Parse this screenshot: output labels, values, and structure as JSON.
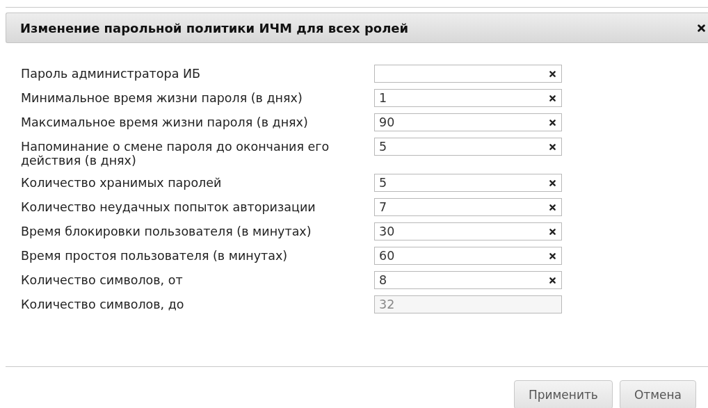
{
  "dialog": {
    "title": "Изменение парольной политики ИЧМ для всех ролей"
  },
  "fields": [
    {
      "label": "Пароль администратора ИБ",
      "disabled": false
    },
    {
      "label": "Минимальное время жизни пароля (в днях)",
      "value": "1",
      "disabled": false
    },
    {
      "label": "Максимальное время жизни пароля (в днях)",
      "value": "90",
      "disabled": false
    },
    {
      "label": "Напоминание о смене пароля до окончания его действия (в днях)",
      "value": "5",
      "disabled": false
    },
    {
      "label": "Количество хранимых паролей",
      "value": "5",
      "disabled": false
    },
    {
      "label": "Количество неудачных попыток авторизации",
      "value": "7",
      "disabled": false
    },
    {
      "label": "Время блокировки пользователя (в минутах)",
      "value": "30",
      "disabled": false
    },
    {
      "label": "Время простоя пользователя (в минутах)",
      "value": "60",
      "disabled": false
    },
    {
      "label": "Количество символов, от",
      "value": "8",
      "disabled": false
    },
    {
      "label": "Количество символов, до",
      "value": "32",
      "disabled": true
    }
  ],
  "buttons": [
    "Применить",
    "Отмена"
  ]
}
